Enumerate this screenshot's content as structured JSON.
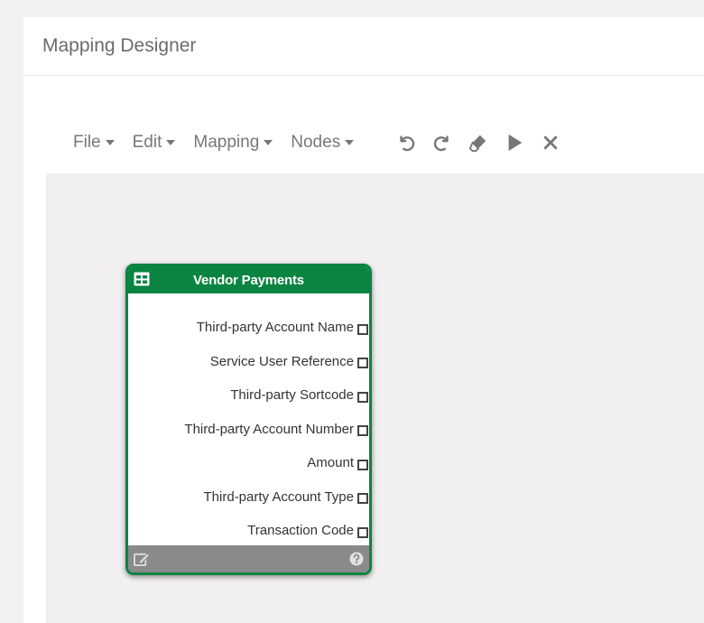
{
  "panel": {
    "title": "Mapping Designer"
  },
  "toolbar": {
    "menus": [
      {
        "label": "File"
      },
      {
        "label": "Edit"
      },
      {
        "label": "Mapping"
      },
      {
        "label": "Nodes"
      }
    ],
    "tools": [
      "undo-icon",
      "redo-icon",
      "eraser-icon",
      "play-icon",
      "close-icon"
    ]
  },
  "node": {
    "title": "Vendor Payments",
    "header_icon": "table-icon",
    "fields": [
      {
        "label": "Third-party Account Name"
      },
      {
        "label": "Service User Reference"
      },
      {
        "label": "Third-party Sortcode"
      },
      {
        "label": "Third-party Account Number"
      },
      {
        "label": "Amount"
      },
      {
        "label": "Third-party Account Type"
      },
      {
        "label": "Transaction Code"
      }
    ],
    "footer_icons": [
      "edit-icon",
      "help-icon"
    ]
  },
  "colors": {
    "node_green": "#0a8441",
    "footer_gray": "#8a8a8a",
    "canvas_bg": "#f1eff0",
    "toolbar_text": "#777777"
  }
}
